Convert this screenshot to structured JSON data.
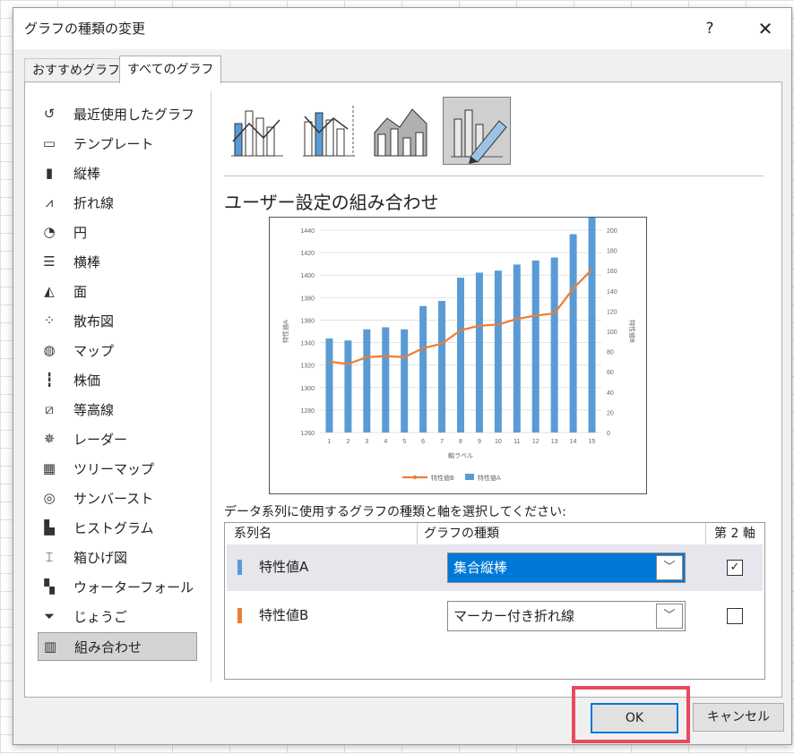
{
  "dialog": {
    "title": "グラフの種類の変更",
    "help": "?",
    "close": "✕"
  },
  "tabs": [
    "おすすめグラフ",
    "すべてのグラフ"
  ],
  "sidebar": [
    {
      "label": "最近使用したグラフ",
      "icon": "recent-icon",
      "glyph": "↺"
    },
    {
      "label": "テンプレート",
      "icon": "folder-icon",
      "glyph": "▭"
    },
    {
      "label": "縦棒",
      "icon": "column-chart-icon",
      "glyph": "▮"
    },
    {
      "label": "折れ線",
      "icon": "line-chart-icon",
      "glyph": "⩘"
    },
    {
      "label": "円",
      "icon": "pie-chart-icon",
      "glyph": "◔"
    },
    {
      "label": "横棒",
      "icon": "bar-chart-icon",
      "glyph": "☰"
    },
    {
      "label": "面",
      "icon": "area-chart-icon",
      "glyph": "◭"
    },
    {
      "label": "散布図",
      "icon": "scatter-chart-icon",
      "glyph": "⁘"
    },
    {
      "label": "マップ",
      "icon": "map-icon",
      "glyph": "◍"
    },
    {
      "label": "株価",
      "icon": "stock-chart-icon",
      "glyph": "┇"
    },
    {
      "label": "等高線",
      "icon": "surface-chart-icon",
      "glyph": "⧄"
    },
    {
      "label": "レーダー",
      "icon": "radar-chart-icon",
      "glyph": "✵"
    },
    {
      "label": "ツリーマップ",
      "icon": "treemap-icon",
      "glyph": "▦"
    },
    {
      "label": "サンバースト",
      "icon": "sunburst-icon",
      "glyph": "◎"
    },
    {
      "label": "ヒストグラム",
      "icon": "histogram-icon",
      "glyph": "▙"
    },
    {
      "label": "箱ひげ図",
      "icon": "box-whisker-icon",
      "glyph": "⌶"
    },
    {
      "label": "ウォーターフォール",
      "icon": "waterfall-icon",
      "glyph": "▚"
    },
    {
      "label": "じょうご",
      "icon": "funnel-icon",
      "glyph": "⏷"
    },
    {
      "label": "組み合わせ",
      "icon": "combo-chart-icon",
      "glyph": "▥"
    }
  ],
  "active_sidebar_index": 18,
  "combo_title": "ユーザー設定の組み合わせ",
  "instruction": "データ系列に使用するグラフの種類と軸を選択してください:",
  "grid": {
    "headers": {
      "series": "系列名",
      "type": "グラフの種類",
      "axis": "第 2 軸"
    },
    "rows": [
      {
        "name": "特性値A",
        "color": "#5b9bd5",
        "type": "集合縦棒",
        "secondary": true
      },
      {
        "name": "特性値B",
        "color": "#ed7d31",
        "type": "マーカー付き折れ線",
        "secondary": false
      }
    ]
  },
  "buttons": {
    "ok": "OK",
    "cancel": "キャンセル"
  },
  "chart_data": {
    "type": "bar",
    "x": [
      1,
      2,
      3,
      4,
      5,
      6,
      7,
      8,
      9,
      10,
      11,
      12,
      13,
      14,
      15
    ],
    "series": [
      {
        "name": "特性値A",
        "type": "bar",
        "axis": "right",
        "color": "#5b9bd5",
        "values": [
          93,
          91,
          102,
          104,
          102,
          125,
          130,
          153,
          158,
          160,
          166,
          170,
          173,
          196,
          214
        ]
      },
      {
        "name": "特性値B",
        "type": "line",
        "axis": "left",
        "color": "#ed7d31",
        "values": [
          1323,
          1321,
          1327,
          1328,
          1327,
          1335,
          1339,
          1351,
          1355,
          1356,
          1361,
          1364,
          1366,
          1388,
          1405
        ]
      }
    ],
    "left_axis": {
      "label": "特性値A",
      "min": 1260,
      "max": 1440,
      "ticks": [
        1260,
        1280,
        1300,
        1320,
        1340,
        1360,
        1380,
        1400,
        1420,
        1440
      ]
    },
    "right_axis": {
      "label": "特性値B",
      "min": 0,
      "max": 200,
      "ticks": [
        0,
        20,
        40,
        60,
        80,
        100,
        120,
        140,
        160,
        180,
        200
      ]
    },
    "xlabel": "軸ラベル",
    "legend": [
      "特性値B",
      "特性値A"
    ],
    "legend_position": "bottom",
    "grid": true
  }
}
